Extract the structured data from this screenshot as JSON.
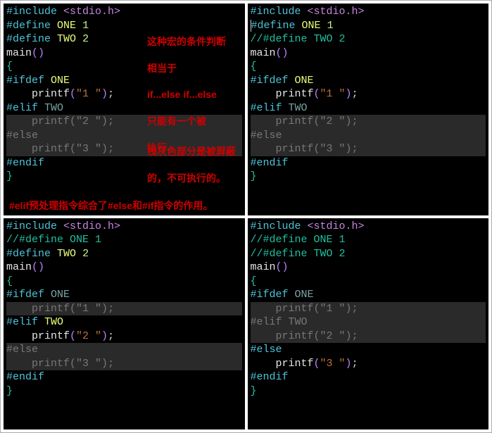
{
  "tokens": {
    "include": "#include",
    "stdio": "<stdio.h>",
    "define": "#define",
    "one": "ONE",
    "two": "TWO",
    "n1": "1",
    "n2": "2",
    "main": "main",
    "lparen": "(",
    "rparen": ")",
    "lbrace": "{",
    "rbrace": "}",
    "ifdef": "#ifdef",
    "elif": "#elif",
    "else": "#else",
    "endif": "#endif",
    "printf": "printf",
    "s1": "\"1 \"",
    "s2": "\"2 \"",
    "s3": "\"3 \"",
    "semi": ";",
    "cmt_def_one": "//#define ONE 1",
    "cmt_def_two": "//#define TWO 2"
  },
  "annotations": {
    "a1_l1": "这种宏的条件判断",
    "a1_l2": "相当于",
    "a1_l3": "if...else if...else",
    "a1_l4": "只能有一个被",
    "a1_l5": "执行",
    "a2_l1": "浅灰色部分是被屏蔽",
    "a2_l2": "的，不可执行的。",
    "bottom": "#elif预处理指令综合了#else和#if指令的作用。"
  }
}
